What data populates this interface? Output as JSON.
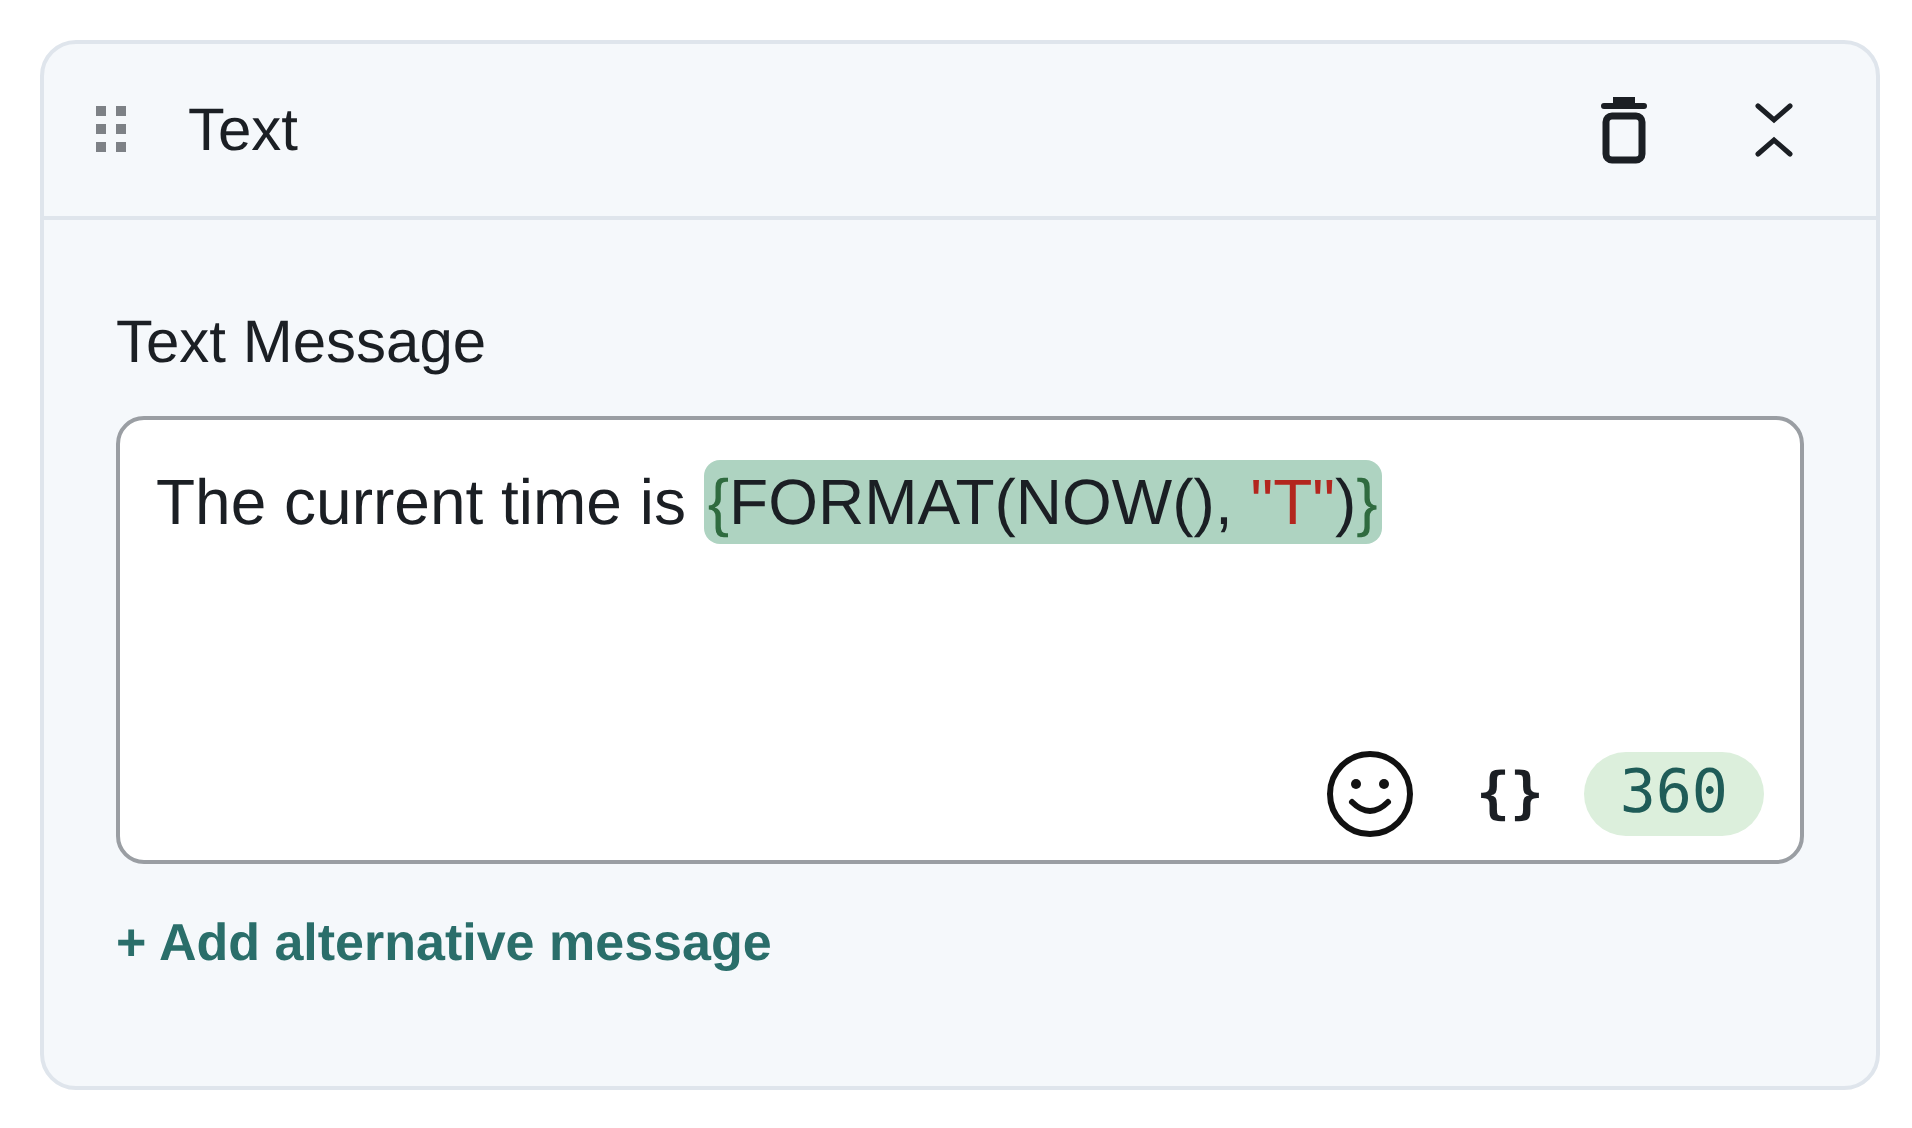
{
  "card": {
    "title": "Text",
    "expanded": true
  },
  "field": {
    "label": "Text Message",
    "prefix": "The current time is ",
    "expression": [
      {
        "kind": "brace",
        "text": "{"
      },
      {
        "kind": "code",
        "text": "FORMAT(NOW(), "
      },
      {
        "kind": "string",
        "text": "\"T\""
      },
      {
        "kind": "code",
        "text": ")"
      },
      {
        "kind": "brace",
        "text": "}"
      }
    ],
    "variable_button": "{}",
    "char_count": "360"
  },
  "add_link": "+ Add alternative message"
}
